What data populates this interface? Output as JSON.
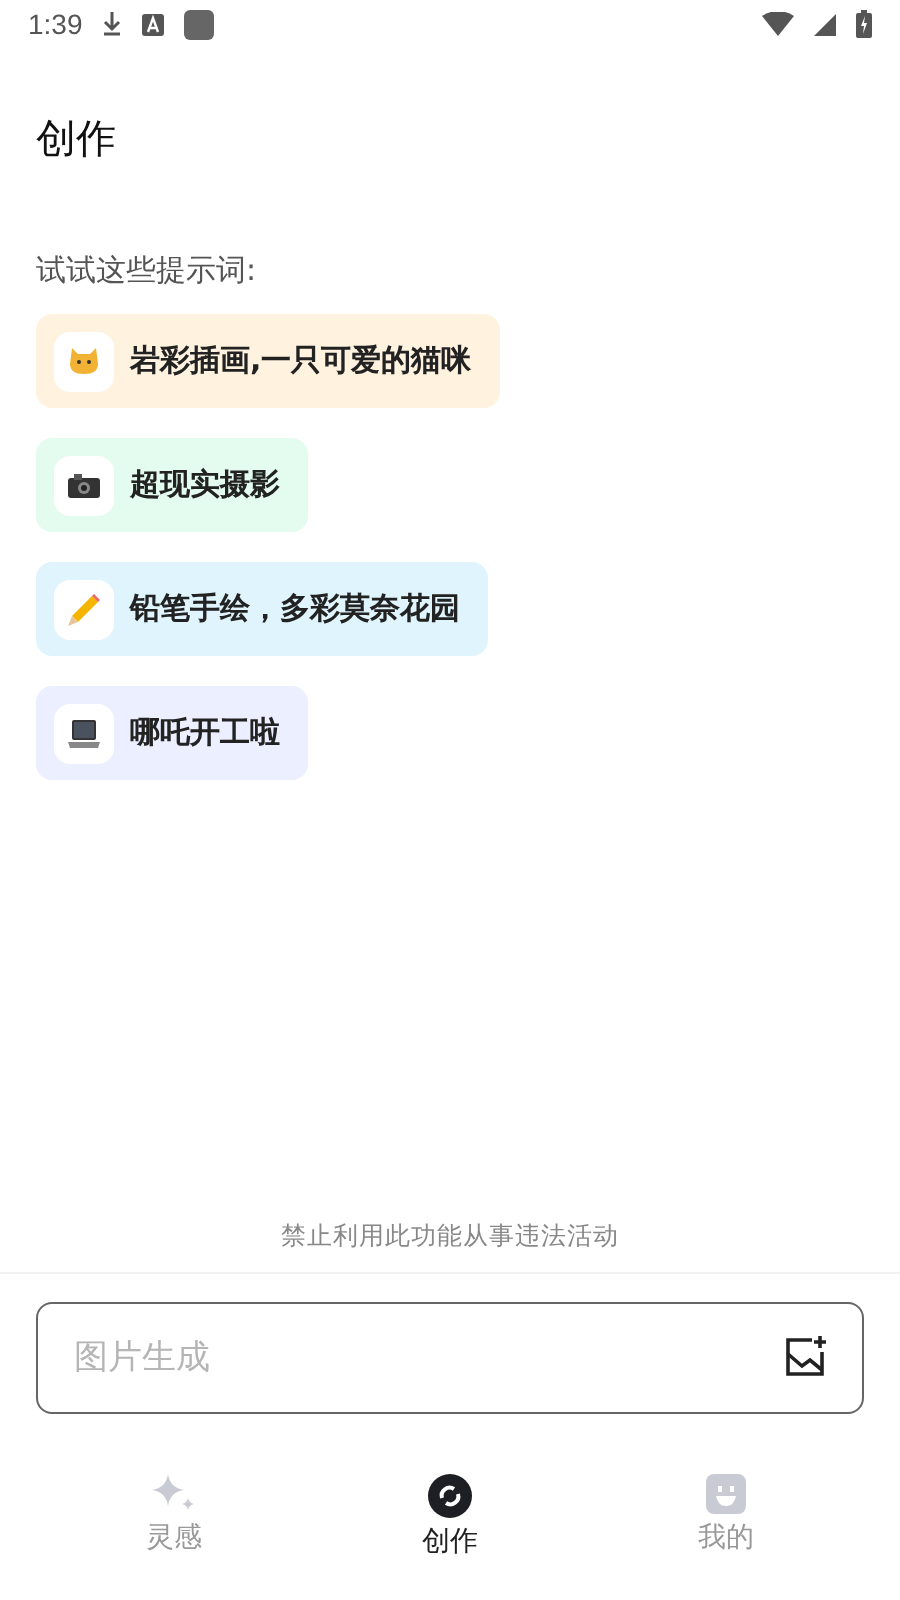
{
  "status_bar": {
    "time": "1:39"
  },
  "title": "创作",
  "prompts_heading": "试试这些提示词:",
  "prompts": [
    {
      "kind": "cat",
      "label": "岩彩插画,一只可爱的猫咪",
      "color": "#fff3e0"
    },
    {
      "kind": "camera",
      "label": "超现实摄影",
      "color": "#e3fcef"
    },
    {
      "kind": "pencil",
      "label": "铅笔手绘，多彩莫奈花园",
      "color": "#dff4fd"
    },
    {
      "kind": "laptop",
      "label": "哪吒开工啦",
      "color": "#ebefff"
    }
  ],
  "notice": "禁止利用此功能从事违法活动",
  "input": {
    "placeholder": "图片生成"
  },
  "nav": [
    {
      "kind": "sparkle",
      "label": "灵感",
      "selected": false
    },
    {
      "kind": "create",
      "label": "创作",
      "selected": true
    },
    {
      "kind": "face",
      "label": "我的",
      "selected": false
    }
  ]
}
